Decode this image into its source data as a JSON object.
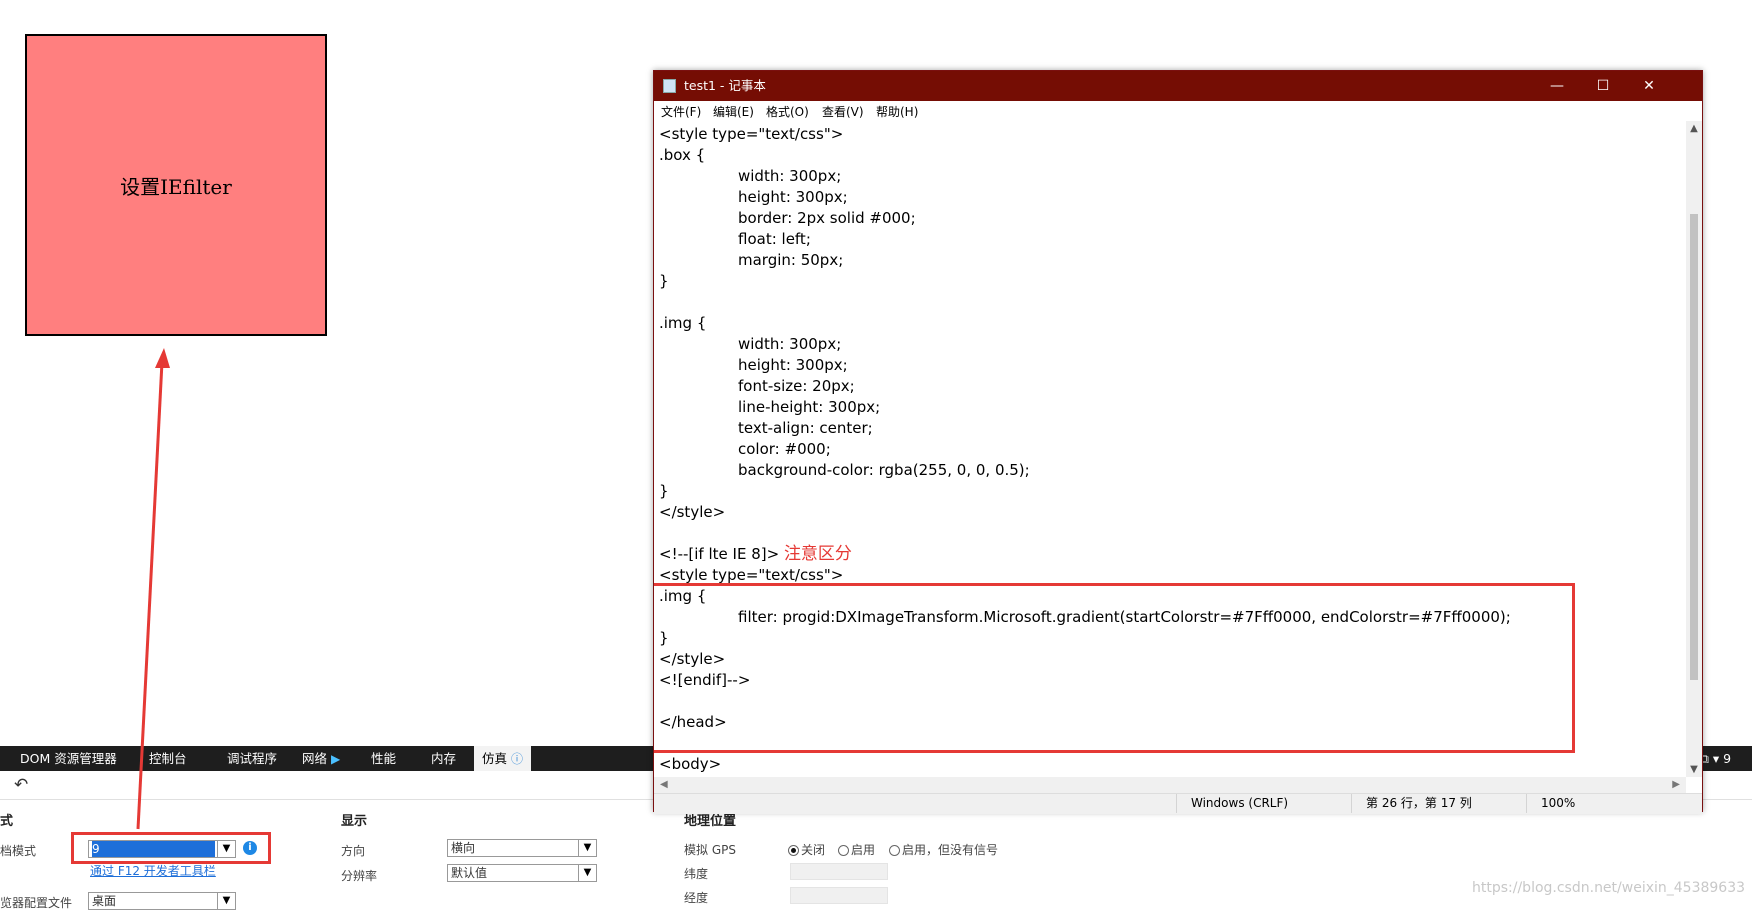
{
  "demo_box": {
    "label": "设置IEfilter"
  },
  "devtools": {
    "tabs": [
      "DOM 资源管理器",
      "控制台",
      "调试程序",
      "网络",
      "性能",
      "内存",
      "仿真"
    ],
    "right_label": "⧉ ▾ 9",
    "sections": {
      "mode": {
        "title": "式",
        "doc_mode_label": "档模式",
        "doc_mode_value": "9",
        "f12_link": "通过 F12 开发者工具栏",
        "profile_label": "览器配置文件",
        "profile_value": "桌面"
      },
      "display": {
        "title": "显示",
        "orientation_label": "方向",
        "orientation_value": "横向",
        "resolution_label": "分辨率",
        "resolution_value": "默认值"
      },
      "geo": {
        "title": "地理位置",
        "gps_label": "模拟 GPS",
        "gps_options": [
          "关闭",
          "启用",
          "启用，但没有信号"
        ],
        "lat_label": "纬度",
        "lon_label": "经度"
      }
    },
    "accent_color": "#1e6fd9",
    "highlight_color": "#e53935"
  },
  "notepad": {
    "title": "test1 - 记事本",
    "menus": [
      "文件(F)",
      "编辑(E)",
      "格式(O)",
      "查看(V)",
      "帮助(H)"
    ],
    "lines": [
      {
        "indent": false,
        "text": "<style type=\"text/css\">"
      },
      {
        "indent": false,
        "text": ".box {"
      },
      {
        "indent": true,
        "text": "width: 300px;"
      },
      {
        "indent": true,
        "text": "height: 300px;"
      },
      {
        "indent": true,
        "text": "border: 2px solid #000;"
      },
      {
        "indent": true,
        "text": "float: left;"
      },
      {
        "indent": true,
        "text": "margin: 50px;"
      },
      {
        "indent": false,
        "text": "}"
      },
      {
        "indent": false,
        "text": ""
      },
      {
        "indent": false,
        "text": ".img {"
      },
      {
        "indent": true,
        "text": "width: 300px;"
      },
      {
        "indent": true,
        "text": "height: 300px;"
      },
      {
        "indent": true,
        "text": "font-size: 20px;"
      },
      {
        "indent": true,
        "text": "line-height: 300px;"
      },
      {
        "indent": true,
        "text": "text-align: center;"
      },
      {
        "indent": true,
        "text": "color: #000;"
      },
      {
        "indent": true,
        "text": "background-color: rgba(255, 0, 0, 0.5);"
      },
      {
        "indent": false,
        "text": "}"
      },
      {
        "indent": false,
        "text": "</style>"
      },
      {
        "indent": false,
        "text": ""
      },
      {
        "indent": false,
        "text": "<!--[if lte IE 8]>"
      },
      {
        "indent": false,
        "text": "<style type=\"text/css\">"
      },
      {
        "indent": false,
        "text": ".img {"
      },
      {
        "indent": true,
        "text": "filter: progid:DXImageTransform.Microsoft.gradient(startColorstr=#7Fff0000, endColorstr=#7Fff0000);"
      },
      {
        "indent": false,
        "text": "}"
      },
      {
        "indent": false,
        "text": "</style>"
      },
      {
        "indent": false,
        "text": "<![endif]-->"
      },
      {
        "indent": false,
        "text": ""
      },
      {
        "indent": false,
        "text": "</head>"
      },
      {
        "indent": false,
        "text": ""
      },
      {
        "indent": false,
        "text": "<body>"
      }
    ],
    "annotation": "注意区分",
    "status": {
      "encoding": "Windows (CRLF)",
      "position": "第 26 行，第 17 列",
      "zoom": "100%"
    },
    "title_bar_color": "#750d04"
  },
  "watermark": "https://blog.csdn.net/weixin_45389633"
}
